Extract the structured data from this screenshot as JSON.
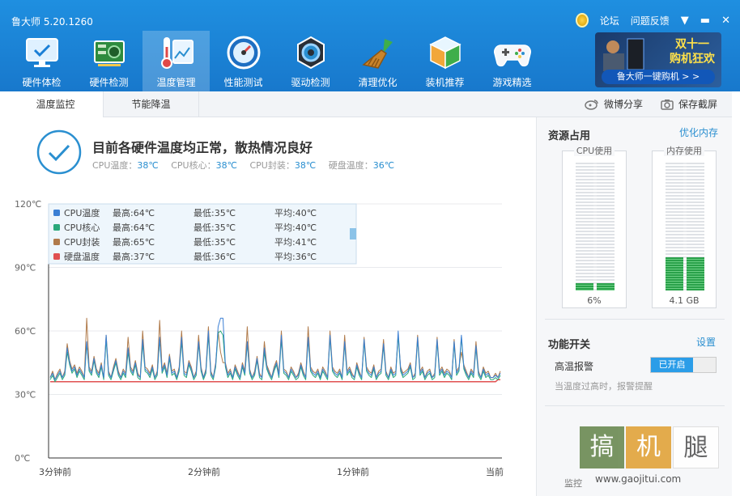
{
  "app": {
    "title": "鲁大师 5.20.1260",
    "forum": "论坛",
    "feedback": "问题反馈",
    "menu_glyph": "▼",
    "min_glyph": "▬",
    "close_glyph": "✕"
  },
  "nav": [
    {
      "label": "硬件体检",
      "icon": "monitor-check-icon"
    },
    {
      "label": "硬件检测",
      "icon": "circuit-board-icon"
    },
    {
      "label": "温度管理",
      "icon": "thermometer-icon",
      "active": true
    },
    {
      "label": "性能测试",
      "icon": "speedometer-icon"
    },
    {
      "label": "驱动检测",
      "icon": "gear-icon"
    },
    {
      "label": "清理优化",
      "icon": "broom-icon"
    },
    {
      "label": "装机推荐",
      "icon": "cube-icon"
    },
    {
      "label": "游戏精选",
      "icon": "gamepad-icon"
    }
  ],
  "promo": {
    "title_line1": "双十一",
    "title_line2": "购机狂欢",
    "subtitle": "鲁大师一键购机 > >"
  },
  "tabs": {
    "monitor": "温度监控",
    "cooling": "节能降温",
    "share": "微博分享",
    "screenshot": "保存截屏"
  },
  "status": {
    "title": "目前各硬件温度均正常，散热情况良好",
    "cpu_temp_label": "CPU温度：",
    "cpu_temp": "38℃",
    "cpu_core_label": "CPU核心：",
    "cpu_core": "38℃",
    "cpu_pkg_label": "CPU封装：",
    "cpu_pkg": "38℃",
    "disk_label": "硬盘温度：",
    "disk": "36℃"
  },
  "legend": [
    {
      "name": "CPU温度",
      "max": "最高:64℃",
      "min": "最低:35℃",
      "avg": "平均:40℃",
      "color": "#3b7fd4"
    },
    {
      "name": "CPU核心",
      "max": "最高:64℃",
      "min": "最低:35℃",
      "avg": "平均:40℃",
      "color": "#2aa87a"
    },
    {
      "name": "CPU封装",
      "max": "最高:65℃",
      "min": "最低:35℃",
      "avg": "平均:41℃",
      "color": "#b07a4a"
    },
    {
      "name": "硬盘温度",
      "max": "最高:37℃",
      "min": "最低:36℃",
      "avg": "平均:36℃",
      "color": "#e05050"
    }
  ],
  "chart_data": {
    "type": "line",
    "ylim": [
      0,
      120
    ],
    "yticks": [
      "0℃",
      "30℃",
      "60℃",
      "90℃",
      "120℃"
    ],
    "xticks": [
      "3分钟前",
      "2分钟前",
      "1分钟前",
      "当前"
    ],
    "series": [
      {
        "name": "CPU温度",
        "color": "#3b7fd4",
        "values": [
          38,
          40,
          37,
          39,
          41,
          38,
          40,
          52,
          45,
          41,
          43,
          39,
          42,
          40,
          38,
          55,
          42,
          40,
          47,
          41,
          39,
          44,
          38,
          58,
          40,
          38,
          42,
          46,
          40,
          38,
          41,
          39,
          52,
          42,
          40,
          45,
          39,
          38,
          56,
          42,
          41,
          39,
          43,
          38,
          40,
          57,
          41,
          44,
          39,
          48,
          40,
          41,
          38,
          42,
          57,
          40,
          39,
          45,
          42,
          38,
          40,
          55,
          42,
          38,
          41,
          60,
          40,
          38,
          44,
          62,
          66,
          66,
          44,
          39,
          41,
          38,
          43,
          40,
          38,
          44,
          40,
          55,
          41,
          38,
          40,
          47,
          39,
          38,
          52,
          43,
          40,
          38,
          42,
          45,
          39,
          58,
          41,
          40,
          38,
          42,
          40,
          38,
          39,
          44,
          40,
          38,
          57,
          42,
          40,
          39,
          41,
          38,
          42,
          40,
          38,
          58,
          42,
          40,
          39,
          41,
          38,
          55,
          40,
          42,
          39,
          38,
          44,
          40,
          38,
          56,
          42,
          40,
          39,
          43,
          38,
          40,
          41,
          54,
          40,
          38,
          42,
          39,
          40,
          60,
          42,
          39,
          40,
          41,
          44,
          38,
          39,
          57,
          40,
          42,
          38,
          40,
          41,
          38,
          39,
          56,
          40,
          42,
          39,
          41,
          40,
          38,
          55,
          40,
          42,
          58,
          43,
          40,
          38,
          41,
          39,
          53,
          40,
          38,
          42,
          39,
          40,
          38,
          38,
          39,
          38,
          40
        ]
      },
      {
        "name": "CPU核心",
        "color": "#2aa87a",
        "values": [
          37,
          39,
          36,
          38,
          40,
          37,
          39,
          50,
          44,
          40,
          42,
          38,
          41,
          39,
          37,
          54,
          41,
          39,
          46,
          40,
          38,
          43,
          37,
          56,
          39,
          37,
          41,
          45,
          39,
          37,
          40,
          38,
          50,
          41,
          39,
          44,
          38,
          37,
          54,
          41,
          40,
          38,
          42,
          37,
          39,
          56,
          40,
          43,
          38,
          47,
          39,
          40,
          37,
          41,
          55,
          39,
          38,
          44,
          41,
          37,
          39,
          54,
          41,
          37,
          40,
          58,
          39,
          37,
          43,
          59,
          60,
          58,
          43,
          38,
          40,
          37,
          42,
          39,
          37,
          43,
          39,
          54,
          40,
          37,
          39,
          46,
          38,
          37,
          50,
          42,
          39,
          37,
          41,
          44,
          38,
          56,
          40,
          39,
          37,
          41,
          39,
          37,
          38,
          43,
          39,
          37,
          56,
          41,
          39,
          38,
          40,
          37,
          41,
          39,
          37,
          57,
          41,
          39,
          38,
          40,
          37,
          54,
          39,
          41,
          38,
          37,
          43,
          39,
          37,
          55,
          41,
          39,
          38,
          42,
          37,
          39,
          40,
          53,
          39,
          37,
          41,
          38,
          39,
          58,
          41,
          38,
          39,
          40,
          43,
          37,
          38,
          56,
          39,
          41,
          37,
          39,
          40,
          37,
          38,
          55,
          39,
          41,
          38,
          40,
          39,
          37,
          54,
          39,
          41,
          57,
          42,
          39,
          37,
          40,
          38,
          52,
          39,
          37,
          41,
          38,
          39,
          37,
          37,
          38,
          37,
          39
        ]
      },
      {
        "name": "CPU封装",
        "color": "#b07a4a",
        "values": [
          38,
          41,
          37,
          40,
          42,
          38,
          41,
          54,
          46,
          42,
          44,
          40,
          43,
          41,
          38,
          66,
          43,
          41,
          48,
          42,
          40,
          45,
          38,
          58,
          41,
          38,
          43,
          47,
          41,
          38,
          42,
          40,
          57,
          43,
          41,
          46,
          40,
          38,
          60,
          43,
          42,
          40,
          44,
          38,
          41,
          65,
          42,
          45,
          40,
          49,
          41,
          42,
          38,
          43,
          60,
          41,
          40,
          46,
          43,
          38,
          41,
          58,
          43,
          38,
          42,
          62,
          41,
          38,
          45,
          60,
          50,
          45,
          45,
          40,
          42,
          38,
          44,
          41,
          38,
          45,
          41,
          62,
          42,
          38,
          41,
          48,
          40,
          38,
          55,
          44,
          41,
          38,
          43,
          46,
          40,
          60,
          42,
          41,
          38,
          43,
          41,
          38,
          40,
          45,
          41,
          38,
          62,
          43,
          41,
          40,
          42,
          38,
          43,
          41,
          38,
          60,
          43,
          41,
          40,
          42,
          38,
          58,
          41,
          43,
          40,
          38,
          45,
          41,
          38,
          57,
          43,
          41,
          40,
          44,
          38,
          41,
          42,
          56,
          41,
          38,
          43,
          40,
          41,
          58,
          43,
          40,
          41,
          42,
          45,
          38,
          40,
          58,
          41,
          43,
          38,
          41,
          42,
          38,
          40,
          57,
          41,
          43,
          40,
          42,
          41,
          38,
          56,
          41,
          43,
          50,
          44,
          41,
          38,
          42,
          40,
          55,
          41,
          38,
          43,
          40,
          41,
          38,
          38,
          40,
          38,
          41
        ]
      },
      {
        "name": "硬盘温度",
        "color": "#e05050",
        "values": [
          36,
          36,
          36,
          36,
          36,
          36,
          36,
          36,
          36,
          36,
          36,
          36,
          36,
          36,
          36,
          36,
          36,
          36,
          36,
          36,
          36,
          36,
          36,
          36,
          36,
          36,
          36,
          36,
          36,
          36,
          36,
          36,
          36,
          36,
          36,
          36,
          36,
          36,
          36,
          36,
          36,
          36,
          36,
          36,
          36,
          36,
          36,
          36,
          36,
          36,
          36,
          36,
          36,
          36,
          36,
          36,
          36,
          36,
          36,
          36,
          36,
          36,
          36,
          36,
          36,
          36,
          36,
          36,
          36,
          36,
          36,
          36,
          36,
          36,
          36,
          36,
          36,
          36,
          36,
          36,
          36,
          36,
          36,
          36,
          36,
          36,
          36,
          36,
          36,
          36,
          36,
          36,
          36,
          36,
          36,
          36,
          36,
          36,
          36,
          36,
          36,
          36,
          36,
          36,
          36,
          36,
          36,
          36,
          36,
          36,
          36,
          36,
          36,
          36,
          36,
          36,
          36,
          36,
          36,
          36,
          36,
          36,
          36,
          36,
          36,
          36,
          36,
          36,
          36,
          36,
          36,
          36,
          36,
          36,
          36,
          36,
          36,
          36,
          36,
          36,
          36,
          36,
          36,
          36,
          36,
          36,
          36,
          36,
          36,
          36,
          36,
          36,
          36,
          36,
          36,
          36,
          36,
          36,
          36,
          36,
          36,
          36,
          36,
          36,
          36,
          36,
          36,
          36,
          36,
          36,
          36,
          36,
          36,
          36,
          36,
          36,
          36,
          36,
          36,
          36,
          36,
          36,
          36,
          36,
          37,
          37
        ]
      }
    ]
  },
  "sidebar": {
    "resources_title": "资源占用",
    "optimize_memory": "优化内存",
    "cpu_label": "CPU使用",
    "cpu_value": "6%",
    "cpu_fraction": 0.06,
    "mem_label": "内存使用",
    "mem_value": "4.1 GB",
    "mem_fraction": 0.26,
    "function_title": "功能开关",
    "settings": "设置",
    "alarm_label": "高温报警",
    "alarm_state": "已开启",
    "alarm_desc": "当温度过高时，报警提醒",
    "footer": "监控",
    "watermark": [
      "搞",
      "机",
      "腿"
    ],
    "watermark_url": "www.gaojitui.com"
  }
}
